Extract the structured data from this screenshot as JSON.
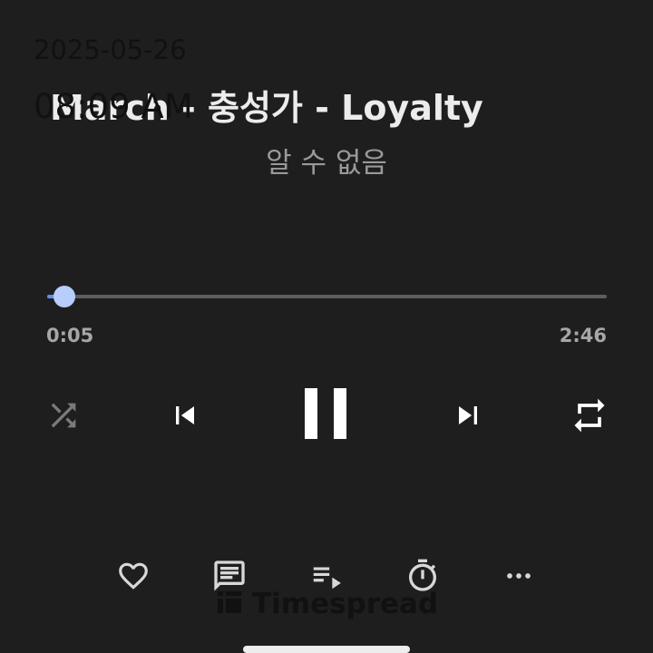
{
  "stamp": {
    "date": "2025-05-26",
    "time": "08:09 AM"
  },
  "song": {
    "title": "March - 충성가 - Loyalty",
    "artist": "알 수 없음"
  },
  "progress": {
    "current": "0:05",
    "total": "2:46",
    "fraction": 0.03
  },
  "controls": {
    "shuffle": "shuffle-icon",
    "previous": "skip-previous-icon",
    "play_pause": "pause-icon",
    "next": "skip-next-icon",
    "repeat": "repeat-icon"
  },
  "toolbar": {
    "items": [
      "heart-icon",
      "lyrics-icon",
      "queue-icon",
      "timer-icon",
      "more-icon"
    ]
  },
  "watermark": {
    "text": "Timespread"
  },
  "colors": {
    "background": "#1e1e1e",
    "accent": "#5f8ff3",
    "thumb": "#b7cdfb",
    "secondary_text": "#9a9a9a"
  }
}
